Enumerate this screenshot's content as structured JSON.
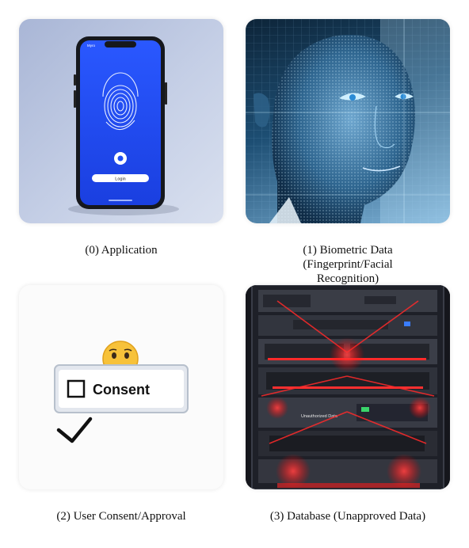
{
  "panels": [
    {
      "caption": "(0) Application",
      "phone": {
        "status_carrier": "Myro",
        "login_label": "Login"
      }
    },
    {
      "caption_line1": "(1) Biometric Data",
      "caption_line2": "(Fingerprint/Facial",
      "caption_line3": "Recognition)"
    },
    {
      "caption": "(2) User Consent/Approval",
      "consent_label": "Consent"
    },
    {
      "caption": "(3) Database (Unapproved Data)",
      "server_label": "Unauthorized Data"
    }
  ],
  "colors": {
    "phone_screen": "#1f4df2",
    "accent_red": "#ff2a2a",
    "face_blue": "#5fb0e8"
  }
}
